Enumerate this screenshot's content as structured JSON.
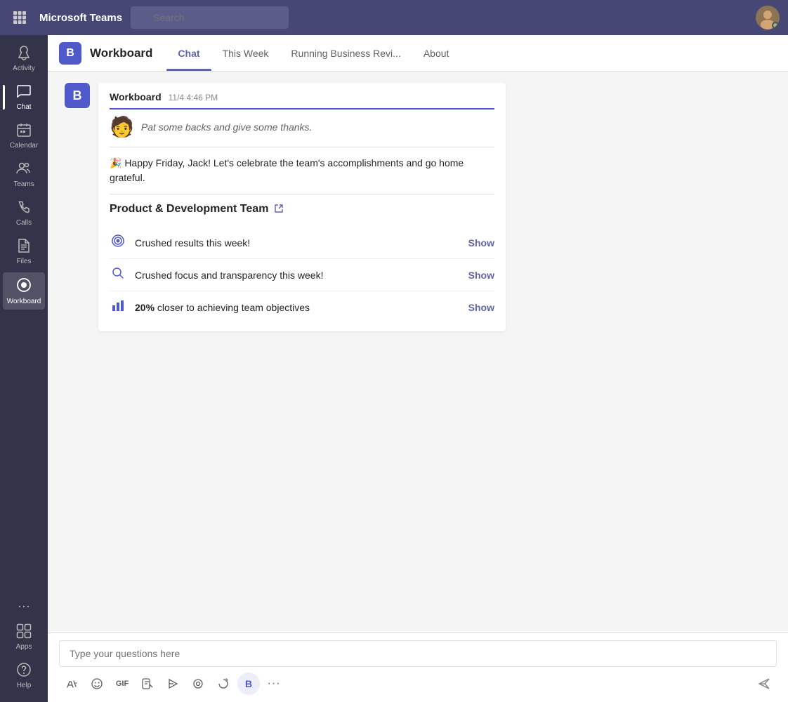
{
  "topbar": {
    "title": "Microsoft Teams",
    "search_placeholder": "Search"
  },
  "sidebar": {
    "items": [
      {
        "id": "activity",
        "label": "Activity",
        "icon": "🔔"
      },
      {
        "id": "chat",
        "label": "Chat",
        "icon": "💬",
        "active": true
      },
      {
        "id": "calendar",
        "label": "Calendar",
        "icon": "📅"
      },
      {
        "id": "teams",
        "label": "Teams",
        "icon": "👥"
      },
      {
        "id": "calls",
        "label": "Calls",
        "icon": "📞"
      },
      {
        "id": "files",
        "label": "Files",
        "icon": "📄"
      },
      {
        "id": "workboard",
        "label": "Workboard",
        "icon": "⊙",
        "active_bottom": true
      }
    ],
    "bottom_items": [
      {
        "id": "more",
        "label": "...",
        "icon": "···"
      },
      {
        "id": "apps",
        "label": "Apps",
        "icon": "⊞"
      },
      {
        "id": "help",
        "label": "Help",
        "icon": "?"
      }
    ]
  },
  "channel": {
    "icon_letter": "B",
    "name": "Workboard",
    "tabs": [
      {
        "id": "chat",
        "label": "Chat",
        "active": true
      },
      {
        "id": "this-week",
        "label": "This Week",
        "active": false
      },
      {
        "id": "running-business",
        "label": "Running Business Revi...",
        "active": false
      },
      {
        "id": "about",
        "label": "About",
        "active": false
      }
    ]
  },
  "message": {
    "sender": "Workboard",
    "time": "11/4 4:46 PM",
    "intro_text": "Pat some backs and give some thanks.",
    "celebration_text": "🎉 Happy Friday, Jack!  Let's celebrate the team's accomplishments and go home grateful.",
    "section_title": "Product & Development Team",
    "metrics": [
      {
        "icon": "🎯",
        "text": "Crushed results this week!",
        "show_label": "Show"
      },
      {
        "icon": "🔍",
        "text": "Crushed focus and transparency this week!",
        "show_label": "Show"
      },
      {
        "icon": "📊",
        "text_prefix": "20%",
        "text_suffix": " closer to achieving team objectives",
        "show_label": "Show"
      }
    ]
  },
  "compose": {
    "placeholder": "Type your questions here",
    "tools": [
      {
        "id": "format",
        "icon": "✏️",
        "label": "Format"
      },
      {
        "id": "emoji",
        "icon": "😊",
        "label": "Emoji"
      },
      {
        "id": "gif",
        "icon": "GIF",
        "label": "GIF"
      },
      {
        "id": "sticker",
        "icon": "🎭",
        "label": "Sticker"
      },
      {
        "id": "send-schedule",
        "icon": "▷",
        "label": "Schedule Send"
      },
      {
        "id": "loop",
        "icon": "⊙",
        "label": "Loop"
      },
      {
        "id": "praise",
        "icon": "↻",
        "label": "Praise"
      },
      {
        "id": "workboard-tool",
        "icon": "B",
        "label": "Workboard"
      },
      {
        "id": "more-tools",
        "icon": "···",
        "label": "More"
      }
    ],
    "send_icon": "➤"
  }
}
